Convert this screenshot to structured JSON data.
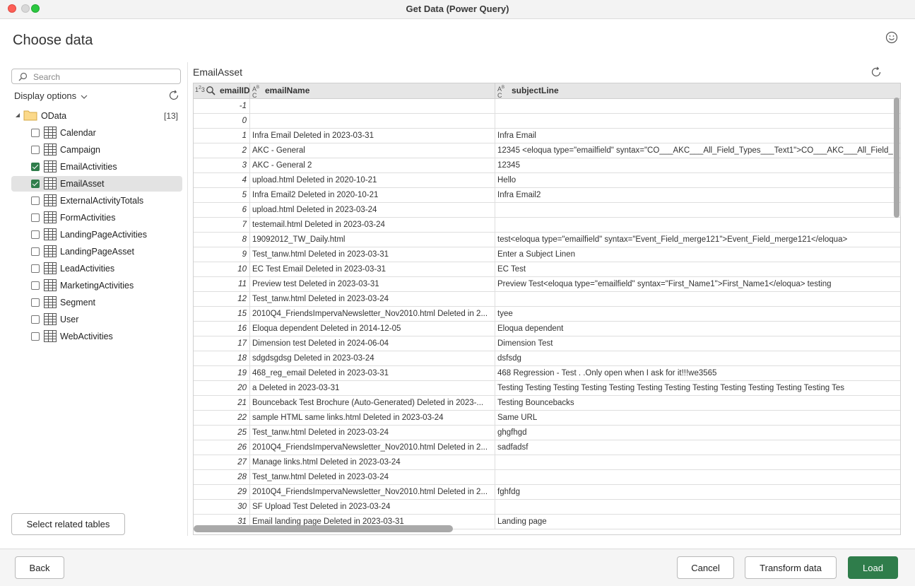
{
  "window": {
    "title": "Get Data (Power Query)"
  },
  "heading": "Choose data",
  "search": {
    "placeholder": "Search",
    "value": ""
  },
  "display_options_label": "Display options",
  "tree": {
    "root_label": "OData",
    "root_count": "[13]",
    "items": [
      {
        "label": "Calendar",
        "checked": false,
        "selected": false
      },
      {
        "label": "Campaign",
        "checked": false,
        "selected": false
      },
      {
        "label": "EmailActivities",
        "checked": true,
        "selected": false
      },
      {
        "label": "EmailAsset",
        "checked": true,
        "selected": true
      },
      {
        "label": "ExternalActivityTotals",
        "checked": false,
        "selected": false
      },
      {
        "label": "FormActivities",
        "checked": false,
        "selected": false
      },
      {
        "label": "LandingPageActivities",
        "checked": false,
        "selected": false
      },
      {
        "label": "LandingPageAsset",
        "checked": false,
        "selected": false
      },
      {
        "label": "LeadActivities",
        "checked": false,
        "selected": false
      },
      {
        "label": "MarketingActivities",
        "checked": false,
        "selected": false
      },
      {
        "label": "Segment",
        "checked": false,
        "selected": false
      },
      {
        "label": "User",
        "checked": false,
        "selected": false
      },
      {
        "label": "WebActivities",
        "checked": false,
        "selected": false
      }
    ]
  },
  "select_related_label": "Select related tables",
  "preview": {
    "title": "EmailAsset",
    "columns": [
      {
        "name": "emailID",
        "type": "123"
      },
      {
        "name": "emailName",
        "type": "ABC"
      },
      {
        "name": "subjectLine",
        "type": "ABC"
      }
    ],
    "rows": [
      [
        "-1",
        "",
        ""
      ],
      [
        "0",
        "",
        ""
      ],
      [
        "1",
        "Infra Email Deleted in 2023-03-31",
        "Infra Email"
      ],
      [
        "2",
        "AKC - General",
        "12345 <eloqua type=\"emailfield\" syntax=\"CO___AKC___All_Field_Types___Text1\">CO___AKC___All_Field_"
      ],
      [
        "3",
        "AKC - General 2",
        "12345"
      ],
      [
        "4",
        "upload.html Deleted in 2020-10-21",
        "Hello"
      ],
      [
        "5",
        "Infra Email2 Deleted in 2020-10-21",
        "Infra Email2"
      ],
      [
        "6",
        "upload.html Deleted in 2023-03-24",
        ""
      ],
      [
        "7",
        "testemail.html Deleted in 2023-03-24",
        ""
      ],
      [
        "8",
        "19092012_TW_Daily.html",
        "test<eloqua type=\"emailfield\" syntax=\"Event_Field_merge121\">Event_Field_merge121</eloqua>"
      ],
      [
        "9",
        "Test_tanw.html Deleted in 2023-03-31",
        "Enter a Subject Linen"
      ],
      [
        "10",
        "EC Test Email Deleted in 2023-03-31",
        "EC Test"
      ],
      [
        "11",
        "Preview test Deleted in 2023-03-31",
        "Preview Test<eloqua type=\"emailfield\" syntax=\"First_Name1\">First_Name1</eloqua>    testing"
      ],
      [
        "12",
        "Test_tanw.html Deleted in 2023-03-24",
        ""
      ],
      [
        "15",
        "2010Q4_FriendsImpervaNewsletter_Nov2010.html Deleted in 2...",
        "tyee"
      ],
      [
        "16",
        "Eloqua dependent Deleted in 2014-12-05",
        "Eloqua dependent"
      ],
      [
        "17",
        "Dimension test Deleted in 2024-06-04",
        "Dimension Test"
      ],
      [
        "18",
        "sdgdsgdsg Deleted in 2023-03-24",
        "dsfsdg"
      ],
      [
        "19",
        "468_reg_email Deleted in 2023-03-31",
        "468 Regression - Test . .Only open when I ask for it!!!we3565"
      ],
      [
        "20",
        "a Deleted in 2023-03-31",
        "Testing Testing  Testing Testing Testing Testing Testing Testing Testing Testing Testing Testing Tes"
      ],
      [
        "21",
        "Bounceback Test Brochure (Auto-Generated) Deleted in 2023-...",
        "Testing Bouncebacks"
      ],
      [
        "22",
        "sample HTML same links.html Deleted in 2023-03-24",
        "Same URL"
      ],
      [
        "25",
        "Test_tanw.html Deleted in 2023-03-24",
        "ghgfhgd"
      ],
      [
        "26",
        "2010Q4_FriendsImpervaNewsletter_Nov2010.html Deleted in 2...",
        "sadfadsf"
      ],
      [
        "27",
        "Manage links.html Deleted in 2023-03-24",
        ""
      ],
      [
        "28",
        "Test_tanw.html Deleted in 2023-03-24",
        ""
      ],
      [
        "29",
        "2010Q4_FriendsImpervaNewsletter_Nov2010.html Deleted in 2...",
        "fghfdg"
      ],
      [
        "30",
        "SF Upload Test Deleted in 2023-03-24",
        ""
      ],
      [
        "31",
        "Email landing page Deleted in 2023-03-31",
        "Landing page"
      ]
    ]
  },
  "footer": {
    "back_label": "Back",
    "cancel_label": "Cancel",
    "transform_label": "Transform data",
    "load_label": "Load"
  },
  "colors": {
    "accent": "#2f7d4b",
    "selection": "#e3e3e3"
  }
}
